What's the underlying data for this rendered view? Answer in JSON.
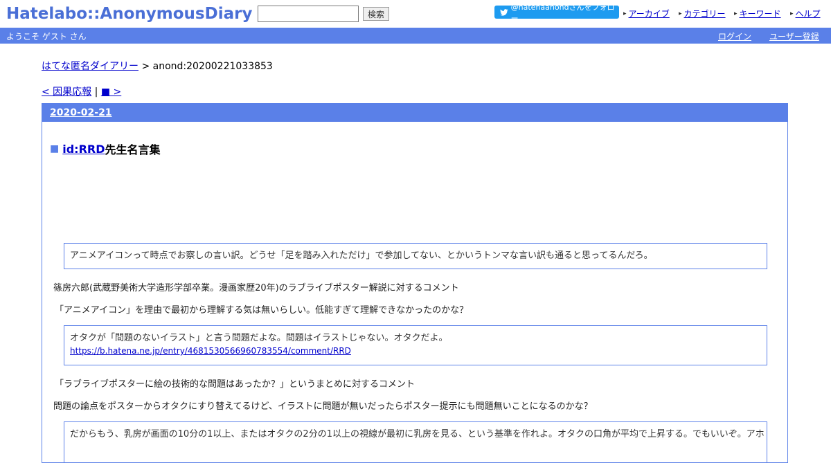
{
  "header": {
    "logo": "Hatelabo::AnonymousDiary",
    "search_value": "",
    "search_button": "検索",
    "twitter_follow": "@hatenaanondさんをフォロー",
    "nav": [
      "アーカイブ",
      "カテゴリー",
      "キーワード",
      "ヘルプ"
    ]
  },
  "bar": {
    "welcome": "ようこそ ゲスト さん",
    "login": "ログイン",
    "register": "ユーザー登録"
  },
  "breadcrumb": {
    "home": "はてな匿名ダイアリー",
    "separator": " > ",
    "current": "anond:20200221033853"
  },
  "pager": {
    "prev": "< 因果応報",
    "separator": " | ",
    "next": "■ >"
  },
  "day": {
    "date": "2020-02-21",
    "title_marker": "■",
    "title_link": "id:RRD",
    "title_rest": "先生名言集"
  },
  "body": {
    "quote1": "アニメアイコンって時点でお察しの言い訳。どうせ「足を踏み入れただけ」で参加してない、とかいうトンマな言い訳も通ると思ってるんだろ。",
    "para1": "篠房六郎(武蔵野美術大学造形学部卒業。漫画家歴20年)のラブライブポスター解説に対するコメント",
    "para2": "「アニメアイコン」を理由で最初から理解する気は無いらしい。低能すぎて理解できなかったのかな？",
    "quote2_text": "オタクが「問題のないイラスト」と言う問題だよな。問題はイラストじゃない。オタクだよ。",
    "quote2_link": "https://b.hatena.ne.jp/entry/4681530566960783554/comment/RRD",
    "para3": "「ラブライブポスターに絵の技術的な問題はあったか？」というまとめに対するコメント",
    "para4": "問題の論点をポスターからオタクにすり替えてるけど、イラストに問題が無いだったらポスター提示にも問題無いことになるのかな？",
    "quote3": "だからもう、乳房が画面の10分の1以上、またはオタクの2分の1以上の視線が最初に乳房を見る、という基準を作れよ。オタクの口角が平均で上昇する。でもいいぞ。アホ"
  },
  "colors": {
    "brand": "#4a6fd6",
    "bar": "#5a80e8",
    "twitter": "#1d9bf0",
    "link": "#0000cc"
  }
}
